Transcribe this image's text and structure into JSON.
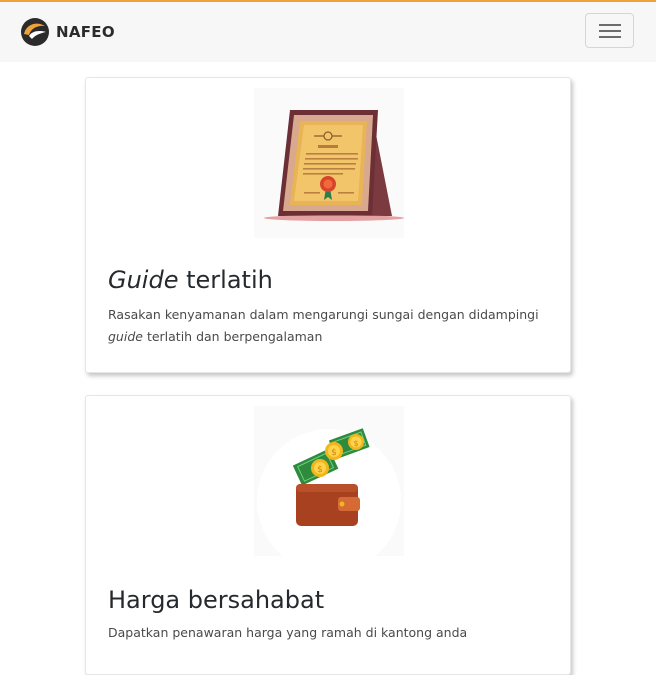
{
  "navbar": {
    "brand_name": "NAFEO",
    "logo_icon": "nafeo-logo-icon",
    "menu_icon": "hamburger-menu-icon",
    "accent_color": "#f0a23a"
  },
  "cards": [
    {
      "illustration": "certificate-icon",
      "title_em": "Guide",
      "title_rest": " terlatih",
      "text_before": "Rasakan kenyamanan dalam mengarungi sungai dengan didampingi",
      "text_em": "guide",
      "text_after": " terlatih dan berpengalaman"
    },
    {
      "illustration": "wallet-money-icon",
      "title": "Harga bersahabat",
      "text": "Dapatkan penawaran harga yang ramah di kantong anda"
    }
  ]
}
